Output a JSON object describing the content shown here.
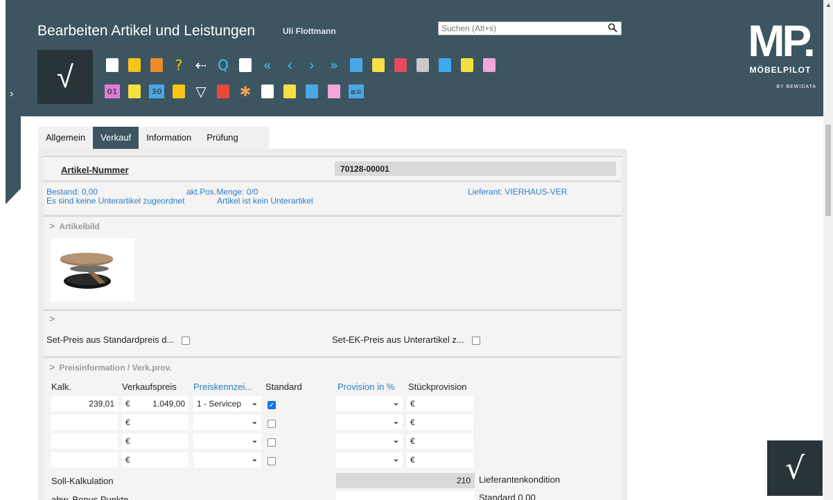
{
  "header": {
    "title": "Bearbeiten Artikel und Leistungen",
    "user": "Uli Flottmann",
    "search_placeholder": "Suchen (Alt+s)",
    "check_symbol": "√",
    "logo": {
      "mark": "MP.",
      "brand": "MÖBELPILOT",
      "by": "BY BEWIDATA"
    },
    "toolbar_row1": [
      {
        "icon": "new-document-icon",
        "glyph": "",
        "color": "#ffffff"
      },
      {
        "icon": "copy-document-icon",
        "glyph": "",
        "color": "#f5c518"
      },
      {
        "icon": "delete-icon",
        "glyph": "",
        "color": "#f08a2a"
      },
      {
        "icon": "help-icon",
        "glyph": "?",
        "color": "#f5c518"
      },
      {
        "icon": "back-icon",
        "glyph": "⇠",
        "color": "#ffffff"
      },
      {
        "icon": "search-icon",
        "glyph": "Q",
        "color": "#3fc5f0"
      },
      {
        "icon": "print-icon",
        "glyph": "",
        "color": "#ffffff"
      },
      {
        "icon": "first-record-icon",
        "glyph": "«",
        "color": "#3fc5f0"
      },
      {
        "icon": "previous-record-icon",
        "glyph": "‹",
        "color": "#3fc5f0"
      },
      {
        "icon": "next-record-icon",
        "glyph": "›",
        "color": "#3fc5f0"
      },
      {
        "icon": "last-record-icon",
        "glyph": "»",
        "color": "#3fc5f0"
      },
      {
        "icon": "articles-icon",
        "glyph": "",
        "color": "#4aa8e8"
      },
      {
        "icon": "coins-icon",
        "glyph": "",
        "color": "#f5e042"
      },
      {
        "icon": "package-icon",
        "glyph": "",
        "color": "#e84a5f"
      },
      {
        "icon": "screw-icon",
        "glyph": "",
        "color": "#c8c8c8"
      },
      {
        "icon": "pie-chart-icon",
        "glyph": "",
        "color": "#3fa8f0"
      },
      {
        "icon": "tags-icon",
        "glyph": "",
        "color": "#f5e042"
      },
      {
        "icon": "documents-icon",
        "glyph": "",
        "color": "#f2a7d8"
      }
    ],
    "toolbar_row2": [
      {
        "icon": "calendar-icon",
        "glyph": "01",
        "color": "#e878d8"
      },
      {
        "icon": "flash-icon",
        "glyph": "",
        "color": "#f5e042"
      },
      {
        "icon": "calendar-30-icon",
        "glyph": "30",
        "color": "#4aa8e8"
      },
      {
        "icon": "sticky-notes-icon",
        "glyph": "",
        "color": "#f5c518"
      },
      {
        "icon": "shield-icon",
        "glyph": "▽",
        "color": "#ffffff"
      },
      {
        "icon": "flag-de-en-icon",
        "glyph": "",
        "color": "#e84a3a"
      },
      {
        "icon": "asterisk-icon",
        "glyph": "✱",
        "color": "#f0a04a"
      },
      {
        "icon": "puzzle-icon",
        "glyph": "",
        "color": "#ffffff"
      },
      {
        "icon": "factory-icon",
        "glyph": "",
        "color": "#f5e042"
      },
      {
        "icon": "truck-icon",
        "glyph": "",
        "color": "#4aa8e8"
      },
      {
        "icon": "document-edit-icon",
        "glyph": "",
        "color": "#f2a7d8"
      },
      {
        "icon": "text-box-icon",
        "glyph": "a≡",
        "color": "#4aa8e8"
      }
    ]
  },
  "tabs": [
    "Allgemein",
    "Verkauf",
    "Information",
    "Prüfung"
  ],
  "article": {
    "number_label": "Artikel-Nummer",
    "number_value": "70128-00001",
    "bestand": "Bestand: 0,00",
    "pos_menge": "akt.Pos.Menge: 0/0",
    "lieferant": "Lieferant: VIERHAUS-VER",
    "unterartikel_none": "Es sind keine Unterartikel zugeordnet",
    "kein_unterartikel": "Artikel ist kein Unterartikel"
  },
  "sections": {
    "artikelbild": "Artikelbild",
    "preisinfo": "Preisinformation / Verk.prov.",
    "chevron": ">"
  },
  "set": {
    "set_preis": "Set-Preis aus Standardpreis d...",
    "set_ek_preis": "Set-EK-Preis aus Unterartikel z..."
  },
  "price_table": {
    "headers": {
      "kalk": "Kalk.",
      "verkaufspreis": "Verkaufspreis",
      "preiskennzeichen": "Preiskennzei...",
      "standard": "Standard",
      "provision": "Provision in %",
      "stueckprovision": "Stückprovision"
    },
    "currency": "€",
    "select_arrow": "⌄",
    "check_mark": "✓",
    "rows": [
      {
        "kalk": "239,01",
        "vk": "1.049,00",
        "kennz": "1 - Servicep",
        "standard": true,
        "provision": "",
        "stueck": ""
      },
      {
        "kalk": "",
        "vk": "",
        "kennz": "",
        "standard": false,
        "provision": "",
        "stueck": ""
      },
      {
        "kalk": "",
        "vk": "",
        "kennz": "",
        "standard": false,
        "provision": "",
        "stueck": ""
      },
      {
        "kalk": "",
        "vk": "",
        "kennz": "",
        "standard": false,
        "provision": "",
        "stueck": ""
      }
    ],
    "soll_kalkulation": "Soll-Kalkulation",
    "soll_value": "210",
    "lieferantenkondition": "Lieferantenkondition",
    "bonus": "abw. Bonus Punkte",
    "standard_value": "Standard 0,00"
  },
  "fab_symbol": "√"
}
